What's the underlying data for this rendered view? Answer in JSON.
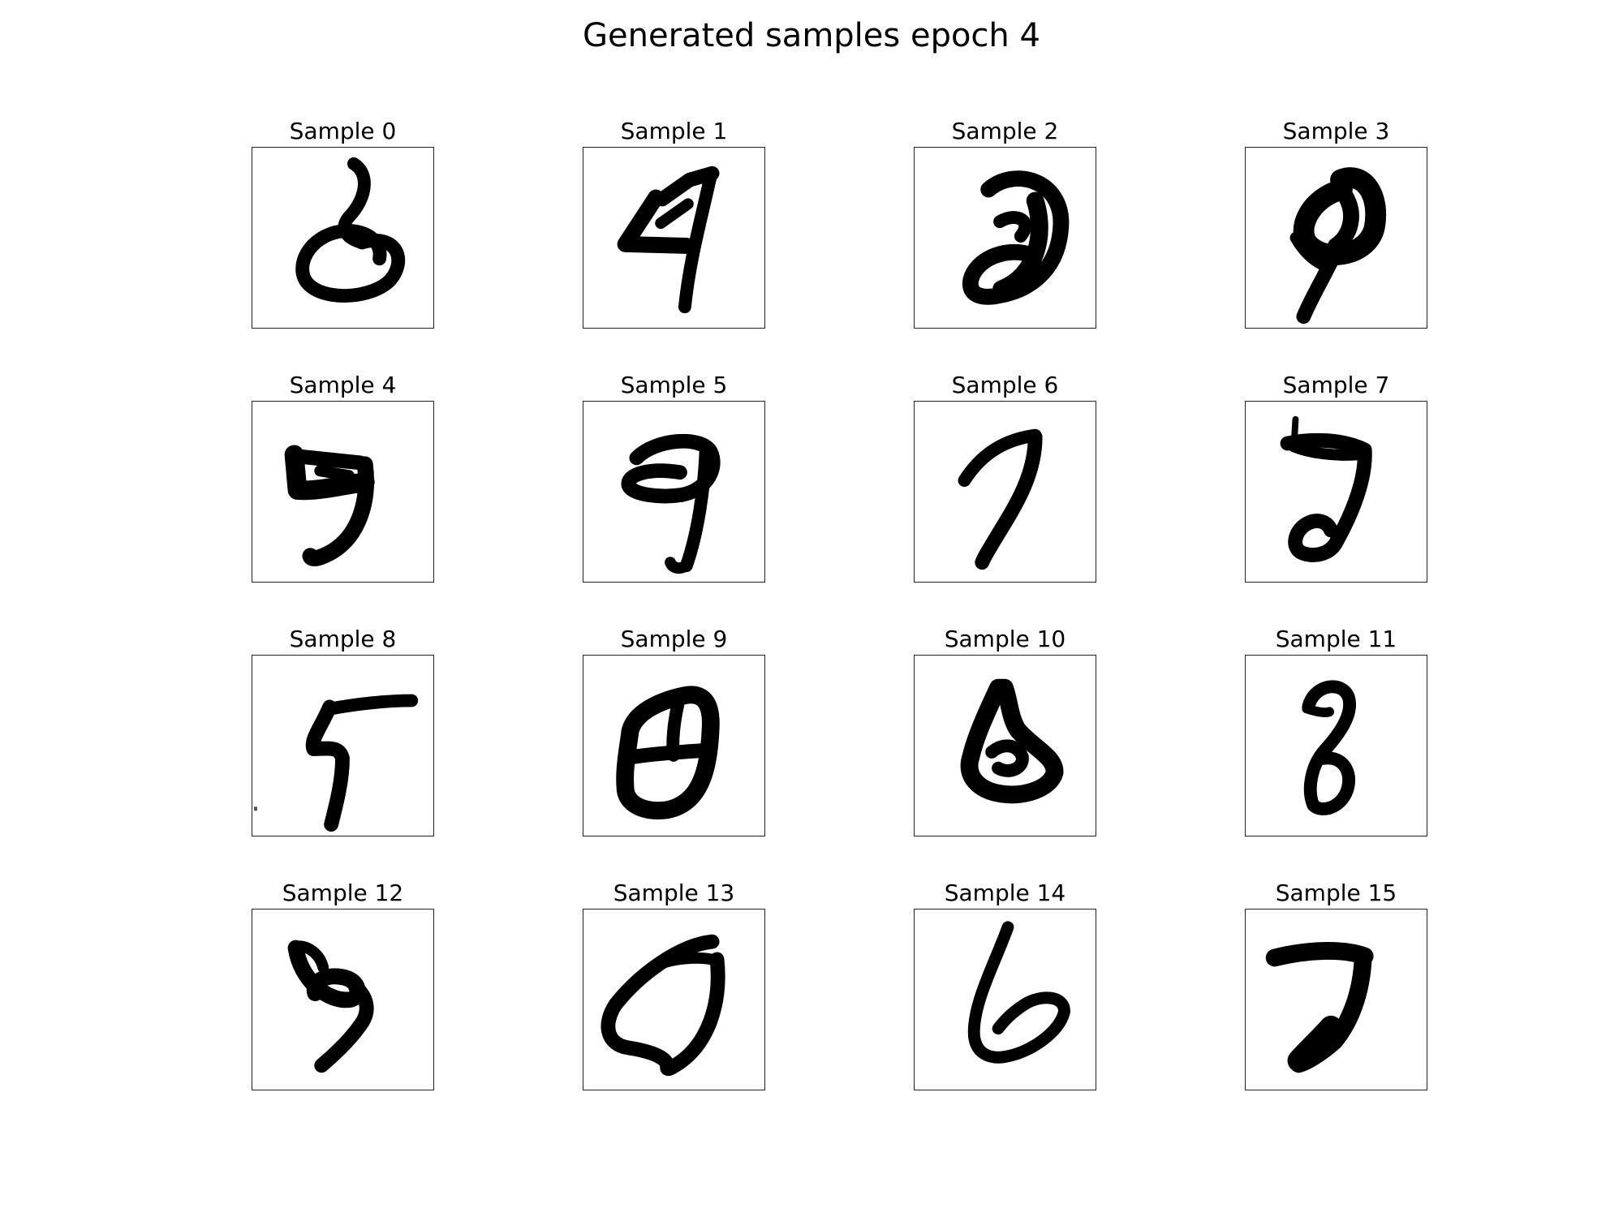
{
  "figure": {
    "title": "Generated samples epoch 4"
  },
  "samples": [
    {
      "title": "Sample 0",
      "digit_glyph": "handwritten-8-loop"
    },
    {
      "title": "Sample 1",
      "digit_glyph": "handwritten-4"
    },
    {
      "title": "Sample 2",
      "digit_glyph": "handwritten-3-filled"
    },
    {
      "title": "Sample 3",
      "digit_glyph": "handwritten-9-blurred"
    },
    {
      "title": "Sample 4",
      "digit_glyph": "handwritten-5"
    },
    {
      "title": "Sample 5",
      "digit_glyph": "handwritten-9"
    },
    {
      "title": "Sample 6",
      "digit_glyph": "handwritten-7"
    },
    {
      "title": "Sample 7",
      "digit_glyph": "handwritten-7-curled"
    },
    {
      "title": "Sample 8",
      "digit_glyph": "handwritten-5-angular"
    },
    {
      "title": "Sample 9",
      "digit_glyph": "handwritten-8-boxy"
    },
    {
      "title": "Sample 10",
      "digit_glyph": "handwritten-8-triangular"
    },
    {
      "title": "Sample 11",
      "digit_glyph": "handwritten-8-narrow"
    },
    {
      "title": "Sample 12",
      "digit_glyph": "handwritten-9-slanted"
    },
    {
      "title": "Sample 13",
      "digit_glyph": "handwritten-0-slanted"
    },
    {
      "title": "Sample 14",
      "digit_glyph": "handwritten-6"
    },
    {
      "title": "Sample 15",
      "digit_glyph": "handwritten-7-thick"
    }
  ]
}
